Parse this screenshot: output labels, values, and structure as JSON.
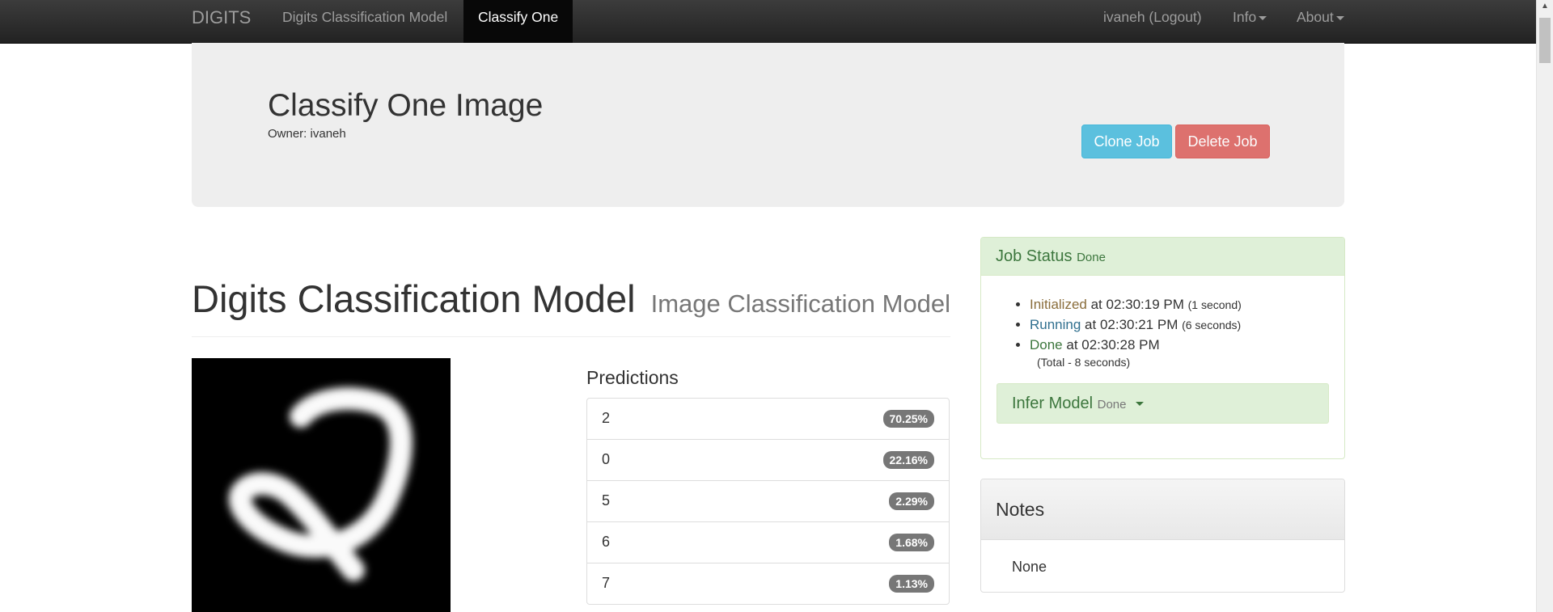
{
  "navbar": {
    "brand": "DIGITS",
    "model_link": "Digits Classification Model",
    "active_tab": "Classify One",
    "user_link": "ivaneh (Logout)",
    "info_menu": "Info",
    "about_menu": "About"
  },
  "jumbotron": {
    "title": "Classify One Image",
    "owner": "Owner: ivaneh",
    "clone_button": "Clone Job",
    "delete_button": "Delete Job"
  },
  "model": {
    "title": "Digits Classification Model",
    "subtitle": "Image Classification Model"
  },
  "predictions": {
    "heading": "Predictions",
    "items": [
      {
        "label": "2",
        "value": "70.25%"
      },
      {
        "label": "0",
        "value": "22.16%"
      },
      {
        "label": "5",
        "value": "2.29%"
      },
      {
        "label": "6",
        "value": "1.68%"
      },
      {
        "label": "7",
        "value": "1.13%"
      }
    ]
  },
  "job_status": {
    "title": "Job Status",
    "status": "Done",
    "steps": [
      {
        "state": "Initialized",
        "at": " at 02:30:19 PM ",
        "duration": "(1 second)"
      },
      {
        "state": "Running",
        "at": " at 02:30:21 PM ",
        "duration": "(6 seconds)"
      },
      {
        "state": "Done",
        "at": " at 02:30:28 PM",
        "duration": ""
      }
    ],
    "total": "(Total - 8 seconds)",
    "infer_title": "Infer Model",
    "infer_status": "Done"
  },
  "notes": {
    "title": "Notes",
    "body": "None"
  },
  "colors": {
    "navbar_bg": "#222222",
    "success_bg": "#dff0d8",
    "success_text": "#3c763d",
    "info_button": "#5bc0de",
    "danger_button": "#d9534f",
    "badge": "#777777"
  }
}
